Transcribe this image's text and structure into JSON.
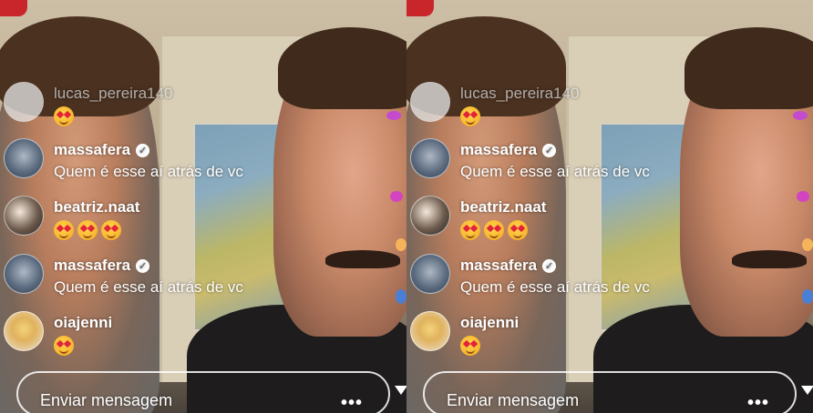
{
  "comments": [
    {
      "username": "lucas_pereira140",
      "verified": false,
      "faded": true,
      "avatar": "blank-avatar",
      "message": "",
      "emoji_count": 1
    },
    {
      "username": "massafera",
      "verified": true,
      "faded": false,
      "avatar": "stars-avatar",
      "message": "Quem é esse aí atrás de vc",
      "emoji_count": 0
    },
    {
      "username": "beatriz.naat",
      "verified": false,
      "faded": false,
      "avatar": "photo-avatar",
      "message": "",
      "emoji_count": 3
    },
    {
      "username": "massafera",
      "verified": true,
      "faded": false,
      "avatar": "stars-avatar",
      "message": "Quem é esse aí atrás de vc",
      "emoji_count": 0
    },
    {
      "username": "oiajenni",
      "verified": false,
      "faded": false,
      "avatar": "blonde-avatar",
      "message": "",
      "emoji_count": 1
    }
  ],
  "message_bar": {
    "placeholder": "Enviar mensagem",
    "more_icon": "more-options-icon",
    "more_glyph": "•••"
  },
  "emoji_icon": "heart-eyes-emoji-icon",
  "colors": {
    "text": "#ffffff",
    "verified_badge": "#ffffff",
    "heart_eye": "#e2243a",
    "emoji_face": "#ffd54a"
  }
}
